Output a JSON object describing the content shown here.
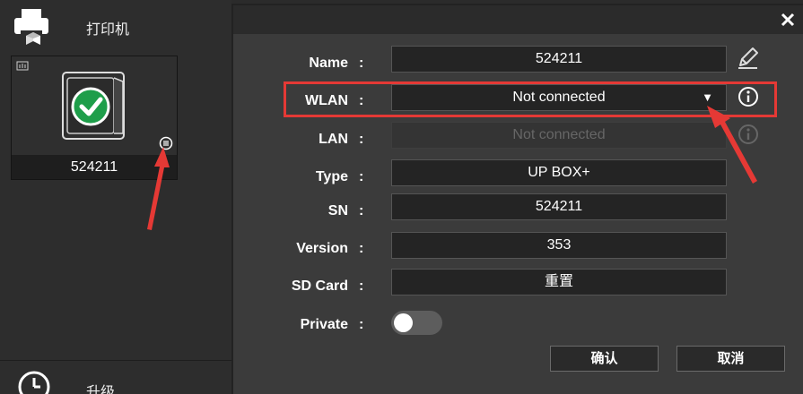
{
  "sidebar": {
    "printer_section_label": "打印机",
    "printer_card": {
      "name": "524211"
    },
    "upgrade_label": "升级"
  },
  "dialog": {
    "fields": {
      "name": {
        "label": "Name",
        "value": "524211"
      },
      "wlan": {
        "label": "WLAN",
        "value": "Not connected"
      },
      "lan": {
        "label": "LAN",
        "value": "Not connected"
      },
      "type": {
        "label": "Type",
        "value": "UP BOX+"
      },
      "sn": {
        "label": "SN",
        "value": "524211"
      },
      "version": {
        "label": "Version",
        "value": "353"
      },
      "sd_card": {
        "label": "SD Card",
        "value": "重置"
      },
      "private": {
        "label": "Private",
        "state": "off"
      }
    },
    "colon": ":",
    "confirm_label": "确认",
    "cancel_label": "取消"
  },
  "colors": {
    "annotation": "#e53935",
    "success": "#1e9e4a",
    "background": "#2b2b2b",
    "dialog": "#3b3b3b"
  }
}
